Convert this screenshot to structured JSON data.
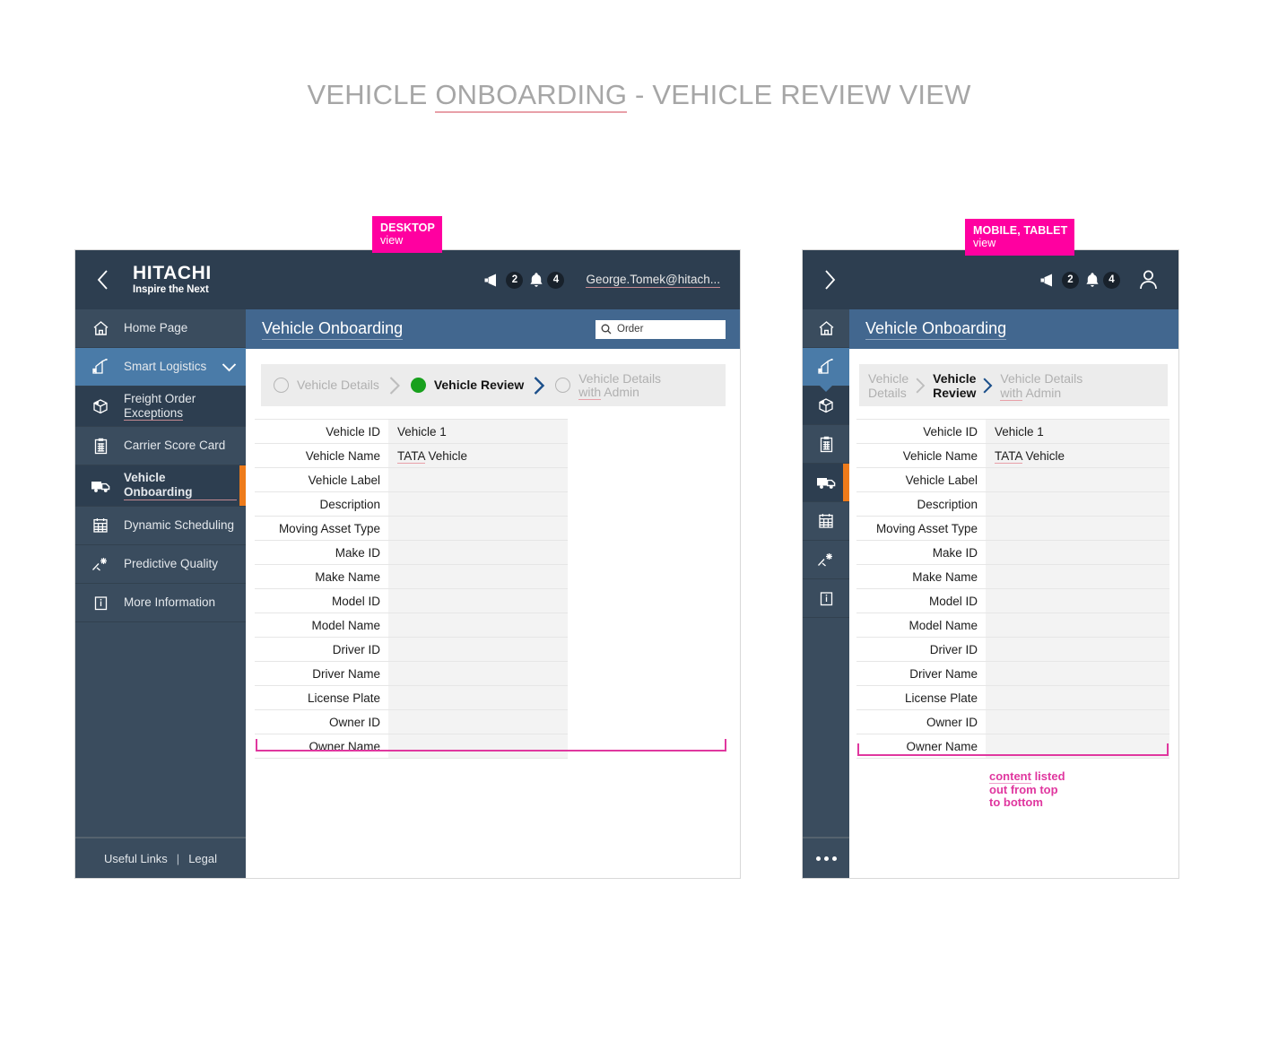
{
  "page": {
    "title_pre": "VEHICLE ",
    "title_spell": "ONBOARDING",
    "title_post": " - VEHICLE REVIEW VIEW"
  },
  "colors": {
    "topbar": "#2d3e50",
    "sidebar": "#3a4c5e",
    "sidebar_active": "#2d3e50",
    "sidebar_highlight": "#4a7ba8",
    "accent_orange": "#ee7b1b",
    "content_header": "#42678f",
    "annotation_pink": "#e0379f",
    "tag_pink": "#ff00a0",
    "step_done_green": "#18a01d",
    "step_arrow_blue": "#1b4f8a"
  },
  "tags": {
    "desktop": {
      "line1": "DESKTOP",
      "line2": "view"
    },
    "mobile": {
      "line1": "MOBILE, TABLET",
      "line2": "view"
    }
  },
  "topbar": {
    "brand_name": "HITACHI",
    "brand_tagline": "Inspire the Next",
    "megaphone_count": "2",
    "bell_count": "4",
    "user_email": "George.Tomek@hitach..."
  },
  "sidebar": {
    "items": [
      {
        "label": "Home Page",
        "icon": "home-icon"
      },
      {
        "label": "Smart Logistics",
        "icon": "logistics-icon",
        "state": "highlight",
        "chevron": "chevron-down-icon"
      },
      {
        "label": "Freight Order Exceptions",
        "label_l1": "Freight Order",
        "label_l2": "Exceptions",
        "icon": "package-icon"
      },
      {
        "label": "Carrier Score Card",
        "icon": "clipboard-icon"
      },
      {
        "label": "Vehicle Onboarding",
        "icon": "truck-icon",
        "state": "active"
      },
      {
        "label": "Dynamic Scheduling",
        "icon": "calendar-icon"
      },
      {
        "label": "Predictive Quality",
        "icon": "sparkle-icon"
      },
      {
        "label": "More Information",
        "icon": "info-icon"
      }
    ],
    "footer": {
      "useful_links": "Useful Links",
      "separator": "|",
      "legal": "Legal"
    },
    "mobile_more": "more-icon"
  },
  "content": {
    "header_title": "Vehicle Onboarding",
    "search": {
      "placeholder": "Order",
      "icon": "search-icon"
    }
  },
  "stepper": {
    "steps": [
      {
        "label": "Vehicle Details",
        "label_l1": "Vehicle",
        "label_l2": "Details",
        "dot": "empty",
        "state": "pending"
      },
      {
        "label": "Vehicle Review",
        "label_l1": "Vehicle",
        "label_l2": "Review",
        "dot": "done",
        "state": "current"
      },
      {
        "label_pre": "Vehicle Details ",
        "label_spell": "with",
        "label_post": " Admin",
        "label_l1": "Vehicle Details",
        "dot": "empty",
        "state": "pending"
      }
    ],
    "arrows": [
      {
        "name": "chevron-right-icon",
        "color": "grey"
      },
      {
        "name": "chevron-right-icon",
        "color": "blue"
      }
    ]
  },
  "form": {
    "rows": [
      {
        "label": "Vehicle ID",
        "value": "Vehicle 1",
        "spell": false
      },
      {
        "label": "Vehicle Name",
        "value": "TATA Vehicle",
        "spell": true,
        "spell_word": "TATA",
        "value_rest": " Vehicle"
      },
      {
        "label": "Vehicle Label",
        "value": ""
      },
      {
        "label": "Description",
        "value": ""
      },
      {
        "label": "Moving Asset Type",
        "value": ""
      },
      {
        "label": "Make ID",
        "value": ""
      },
      {
        "label": "Make Name",
        "value": ""
      },
      {
        "label": "Model ID",
        "value": ""
      },
      {
        "label": "Model Name",
        "value": ""
      },
      {
        "label": "Driver ID",
        "value": ""
      },
      {
        "label": "Driver Name",
        "value": ""
      },
      {
        "label": "License Plate",
        "value": ""
      },
      {
        "label": "Owner ID",
        "value": ""
      },
      {
        "label": "Owner Name",
        "value": ""
      }
    ]
  },
  "annotations": {
    "mobile_note_l1_u": "content",
    "mobile_note_l1_rest": " listed",
    "mobile_note_l2": "out from top",
    "mobile_note_l3": "to bottom"
  }
}
